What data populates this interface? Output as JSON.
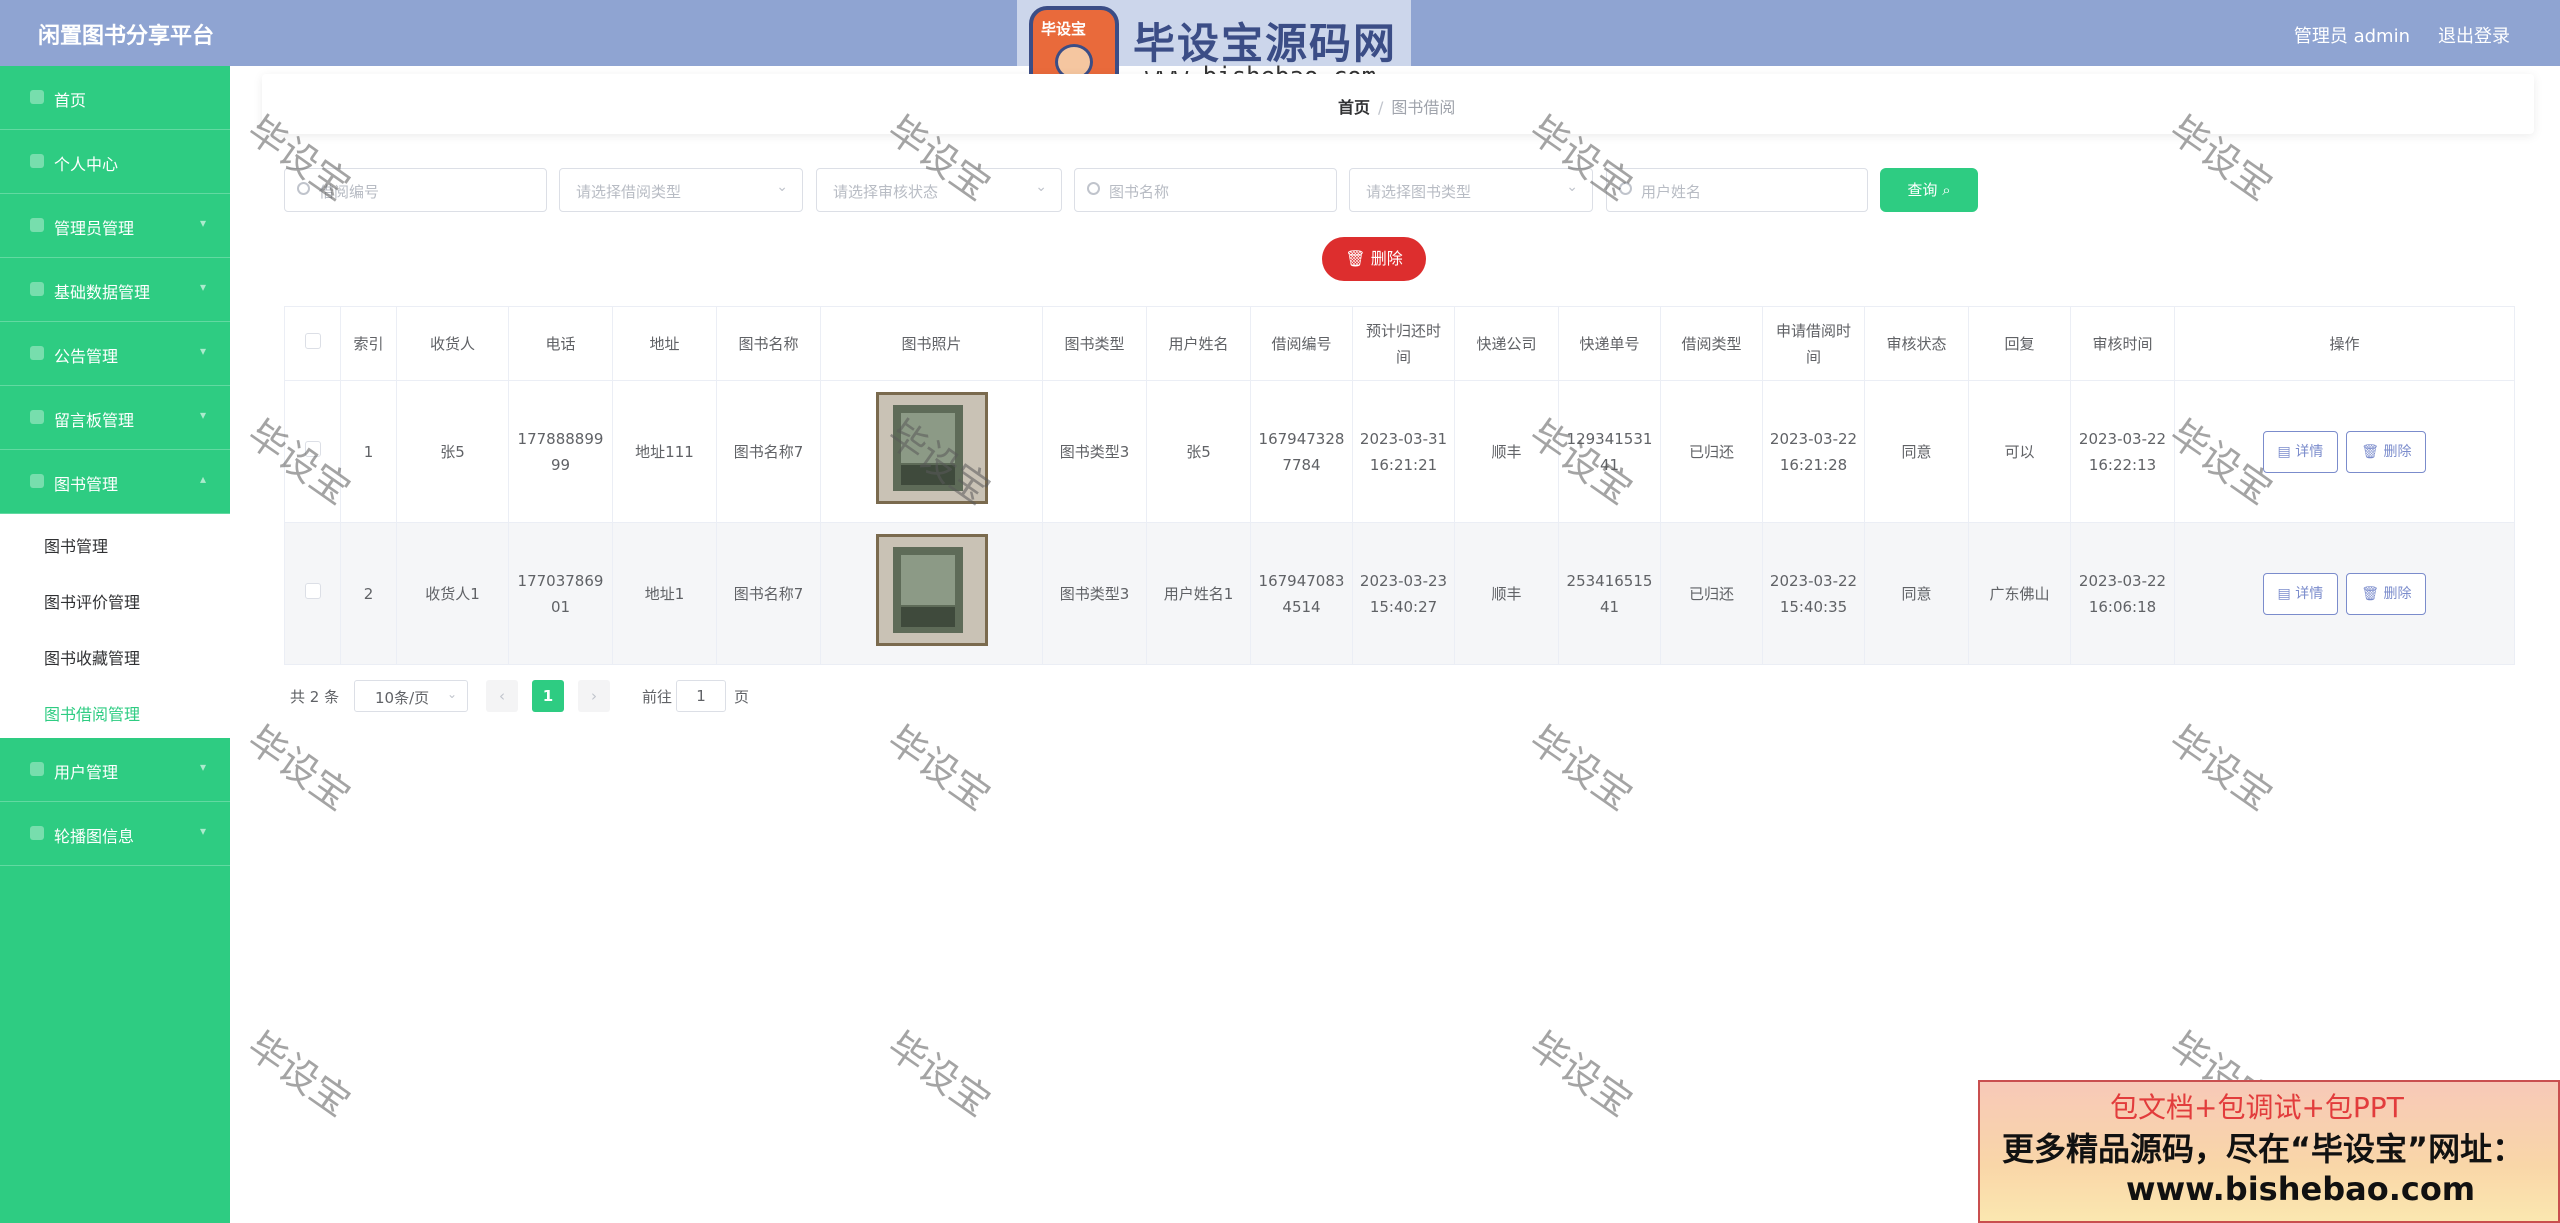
{
  "header": {
    "app_title": "闲置图书分享平台",
    "admin_label": "管理员 admin",
    "logout_label": "退出登录"
  },
  "logo": {
    "badge_text": "毕设宝",
    "main_text": "毕设宝源码网",
    "url_text": "www.bishebao.com"
  },
  "sidebar": {
    "items": [
      {
        "label": "首页"
      },
      {
        "label": "个人中心"
      },
      {
        "label": "管理员管理"
      },
      {
        "label": "基础数据管理"
      },
      {
        "label": "公告管理"
      },
      {
        "label": "留言板管理"
      },
      {
        "label": "图书管理"
      }
    ],
    "subitems": [
      {
        "label": "图书管理"
      },
      {
        "label": "图书评价管理"
      },
      {
        "label": "图书收藏管理"
      },
      {
        "label": "图书借阅管理"
      }
    ],
    "items_after": [
      {
        "label": "用户管理"
      },
      {
        "label": "轮播图信息"
      }
    ]
  },
  "breadcrumb": {
    "home": "首页",
    "separator": "/",
    "current": "图书借阅"
  },
  "filters": {
    "borrow_no": "借阅编号",
    "borrow_type": "请选择借阅类型",
    "review_status": "请选择审核状态",
    "book_name": "图书名称",
    "book_type": "请选择图书类型",
    "user_name": "用户姓名",
    "query_label": "查询"
  },
  "delete_top_label": "删除",
  "table": {
    "headers": [
      "索引",
      "收货人",
      "电话",
      "地址",
      "图书名称",
      "图书照片",
      "图书类型",
      "用户姓名",
      "借阅编号",
      "预计归还时间",
      "快递公司",
      "快递单号",
      "借阅类型",
      "申请借阅时间",
      "审核状态",
      "回复",
      "审核时间",
      "操作"
    ],
    "rows": [
      {
        "index": "1",
        "receiver": "张5",
        "phone": "17788889999",
        "address": "地址111",
        "book_name": "图书名称7",
        "book_type": "图书类型3",
        "user_name": "张5",
        "borrow_no": "1679473287784",
        "return_time": "2023-03-31 16:21:21",
        "courier": "顺丰",
        "tracking_no": "12934153141",
        "borrow_type": "已归还",
        "apply_time": "2023-03-22 16:21:28",
        "review_status": "同意",
        "reply": "可以",
        "review_time": "2023-03-22 16:22:13"
      },
      {
        "index": "2",
        "receiver": "收货人1",
        "phone": "17703786901",
        "address": "地址1",
        "book_name": "图书名称7",
        "book_type": "图书类型3",
        "user_name": "用户姓名1",
        "borrow_no": "1679470834514",
        "return_time": "2023-03-23 15:40:27",
        "courier": "顺丰",
        "tracking_no": "25341651541",
        "borrow_type": "已归还",
        "apply_time": "2023-03-22 15:40:35",
        "review_status": "同意",
        "reply": "广东佛山",
        "review_time": "2023-03-22 16:06:18"
      }
    ],
    "detail_label": "详情",
    "delete_label": "删除"
  },
  "pagination": {
    "total": "共 2 条",
    "page_size": "10条/页",
    "current_page": "1",
    "goto_prefix": "前往",
    "goto_value": "1",
    "goto_suffix": "页"
  },
  "watermark_text": "毕设宝",
  "promo": {
    "line1": "包文档+包调试+包PPT",
    "line2": "更多精品源码，尽在“毕设宝”网址：",
    "line3": "www.bishebao.com"
  },
  "colors": {
    "header_bg": "#8fa4d2",
    "sidebar_bg": "#2ecc82",
    "primary": "#2ecc82",
    "danger": "#dd2e2e",
    "outline_btn": "#7b8ccc"
  }
}
